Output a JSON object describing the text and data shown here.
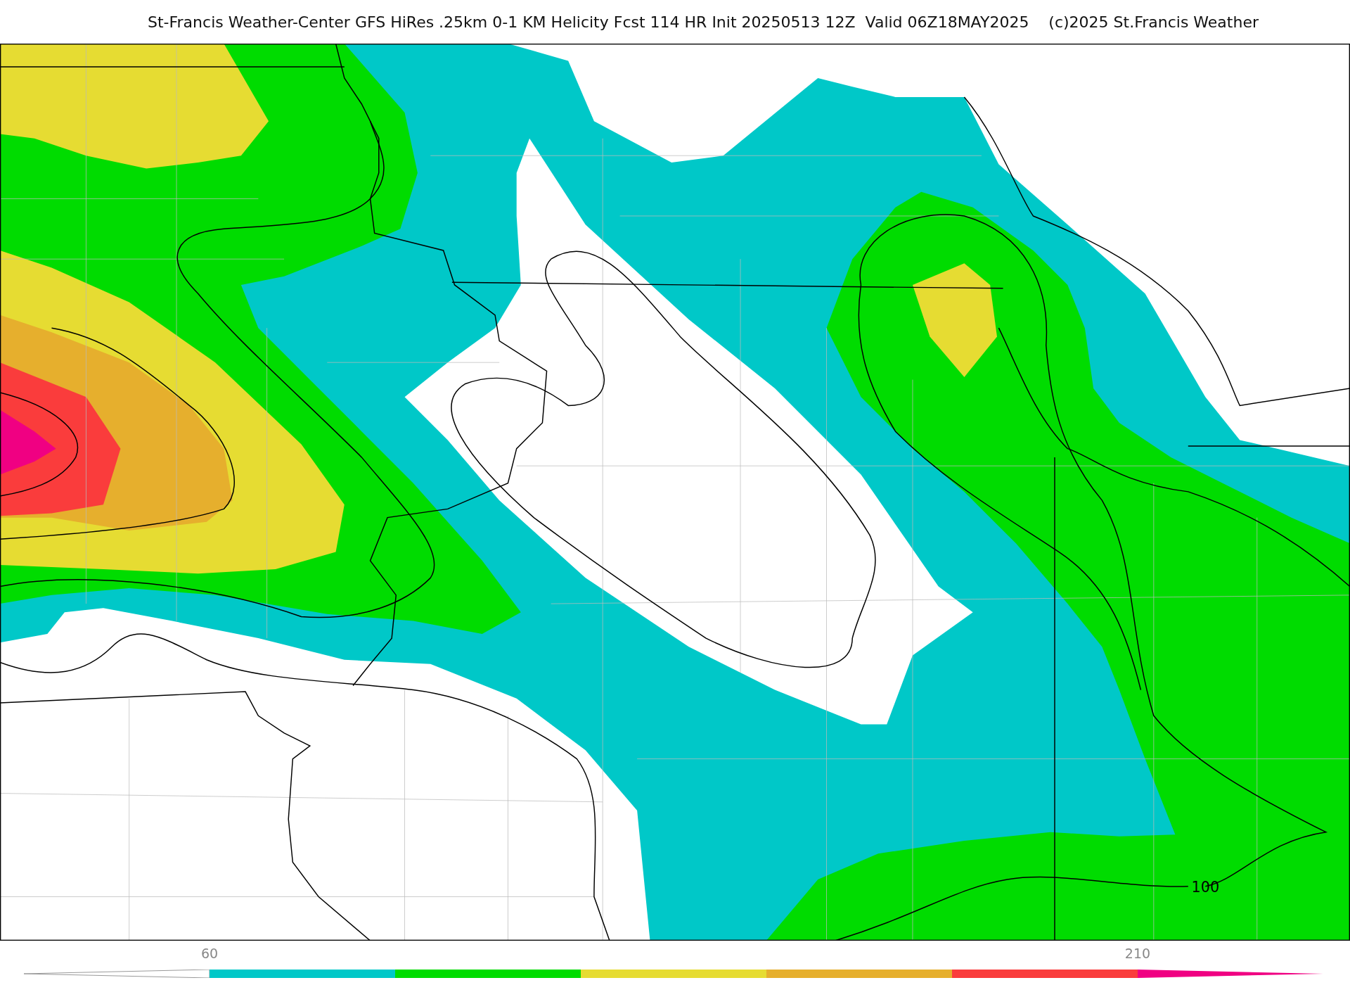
{
  "title": "St-Francis Weather-Center GFS HiRes .25km 0-1 KM Helicity Fcst 114 HR Init 20250513 12Z  Valid 06Z18MAY2025    (c)2025 St.Francis Weather",
  "map": {
    "contour_labels": [
      "100"
    ]
  },
  "colorbar": {
    "segments": [
      {
        "kind": "bar",
        "color": "#00c8c8",
        "tick_label": "60"
      },
      {
        "kind": "bar",
        "color": "#00dc00"
      },
      {
        "kind": "bar",
        "color": "#e6dc32"
      },
      {
        "kind": "bar",
        "color": "#e6af2d"
      },
      {
        "kind": "bar",
        "color": "#fa3c3c"
      },
      {
        "kind": "arrow",
        "color": "#f00082",
        "tick_label": "210"
      }
    ]
  }
}
